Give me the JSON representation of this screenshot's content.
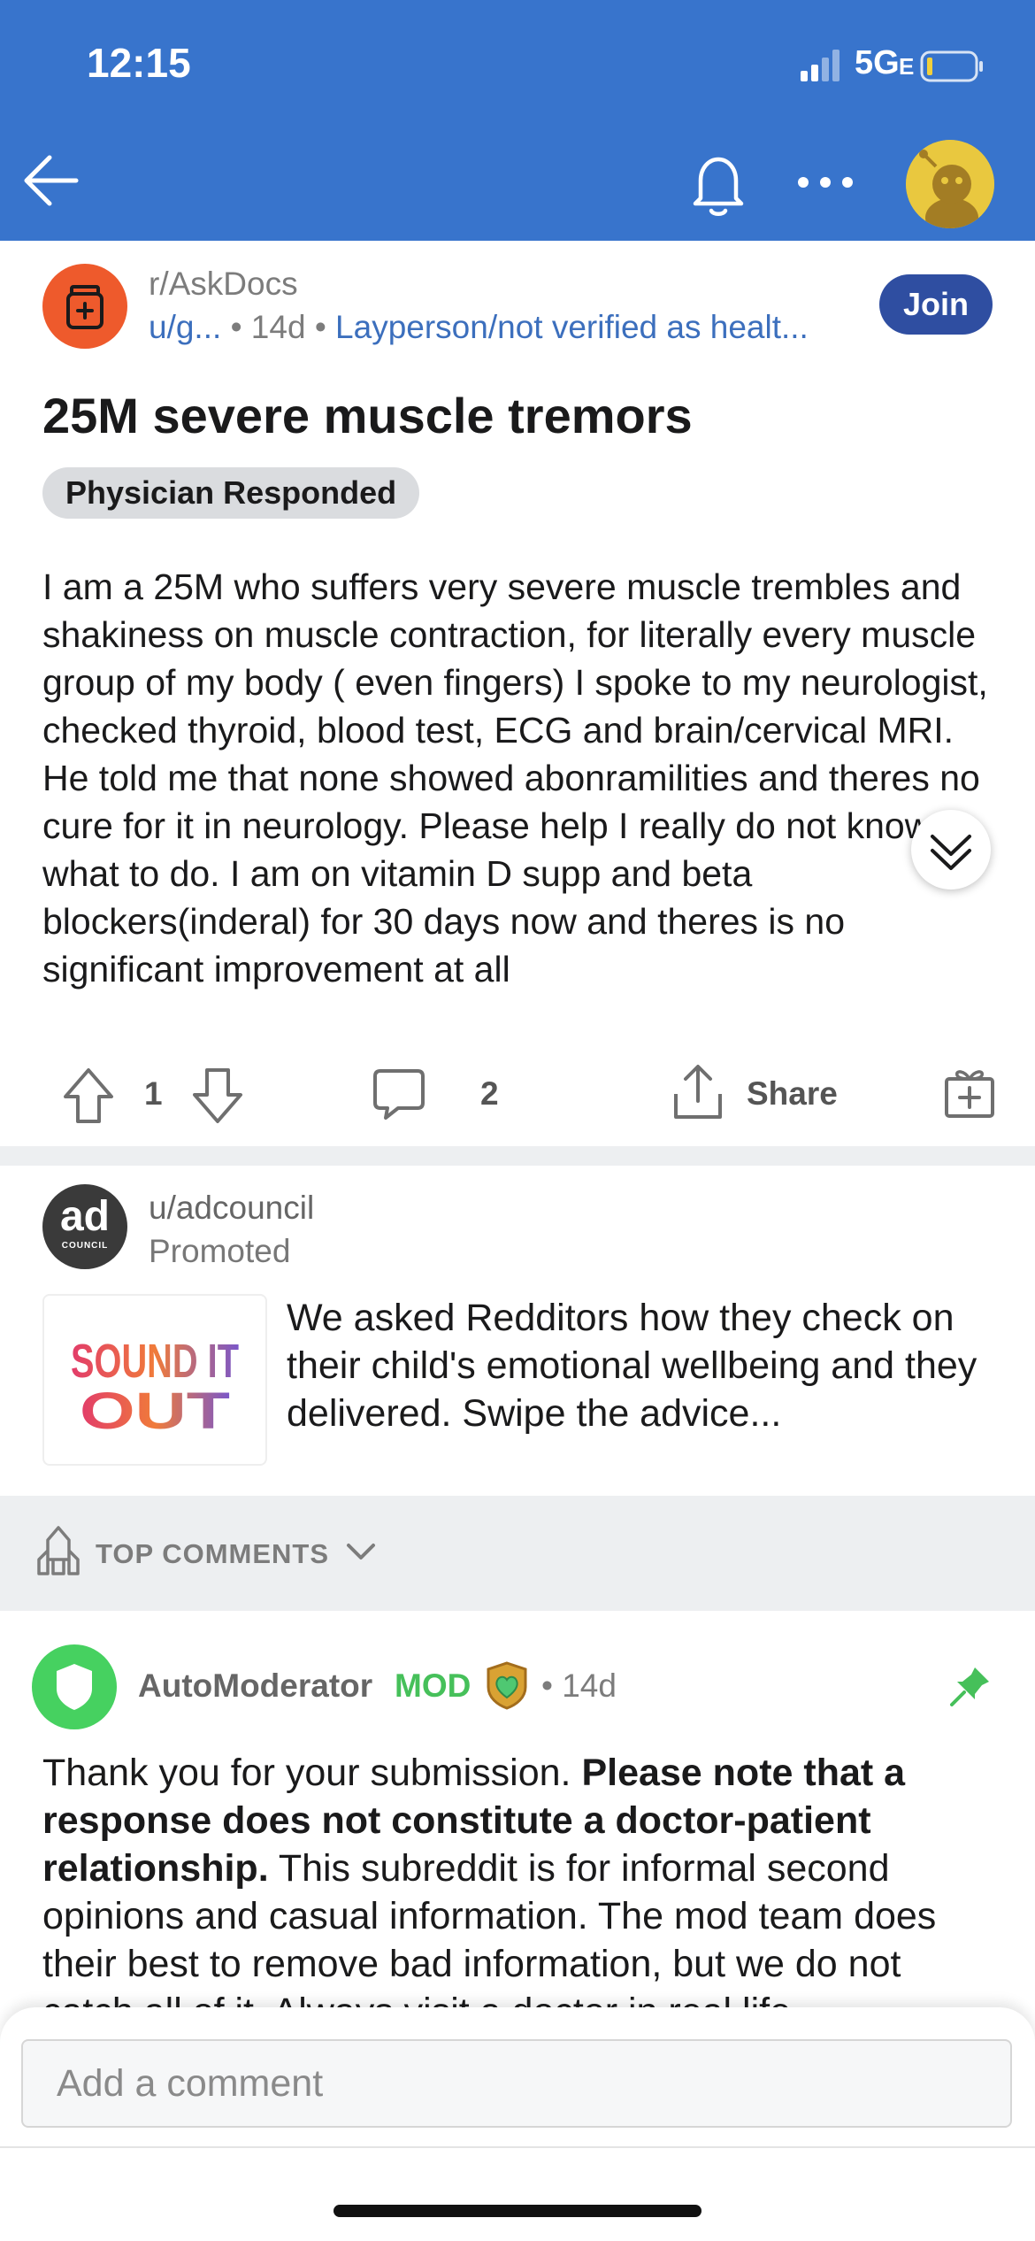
{
  "status_bar": {
    "time": "12:15",
    "network": "5G",
    "network_suffix": "E"
  },
  "header": {
    "back_icon": "arrow-left-icon",
    "bell_icon": "bell-icon",
    "more_icon": "more-dots-icon",
    "avatar_icon": "user-avatar-icon",
    "bar_color": "#3874cc"
  },
  "post": {
    "subreddit": "r/AskDocs",
    "author": "u/g...",
    "age": "14d",
    "user_flair": "Layperson/not verified as healt...",
    "join_label": "Join",
    "title": "25M severe muscle tremors",
    "post_flair": "Physician Responded",
    "body": "I am a 25M who suffers very severe muscle trembles and shakiness on muscle contraction, for literally every muscle group of my body ( even fingers) I spoke to my neurologist, checked thyroid, blood test, ECG and brain/cervical MRI. He told me that none showed abonramilities and theres no cure for it in neurology. Please help I really do not know what to do. I am on vitamin D supp and beta blockers(inderal) for 30 days now and theres is no significant improvement at all",
    "votes": "1",
    "comments": "2",
    "share_label": "Share"
  },
  "ad": {
    "user": "u/adcouncil",
    "promoted_label": "Promoted",
    "avatar_text": "ad",
    "avatar_subtext": "COUNCIL",
    "thumb_line1": "SOUND IT",
    "thumb_line2": "OUT",
    "text": "We asked Redditors how they check on their child's emotional wellbeing and they delivered. Swipe the advice..."
  },
  "sort": {
    "label": "TOP COMMENTS"
  },
  "comment": {
    "author": "AutoModerator",
    "mod_tag": "MOD",
    "age": "14d",
    "text_1": "Thank you for your submission. ",
    "text_bold": "Please note that a response does not constitute a doctor-patient relationship.",
    "text_2": " This subreddit is for informal second opinions and casual information. The mod team does their best to remove bad information, but we do not catch all of it. Always visit a doctor in real life"
  },
  "composer": {
    "placeholder": "Add a comment"
  }
}
